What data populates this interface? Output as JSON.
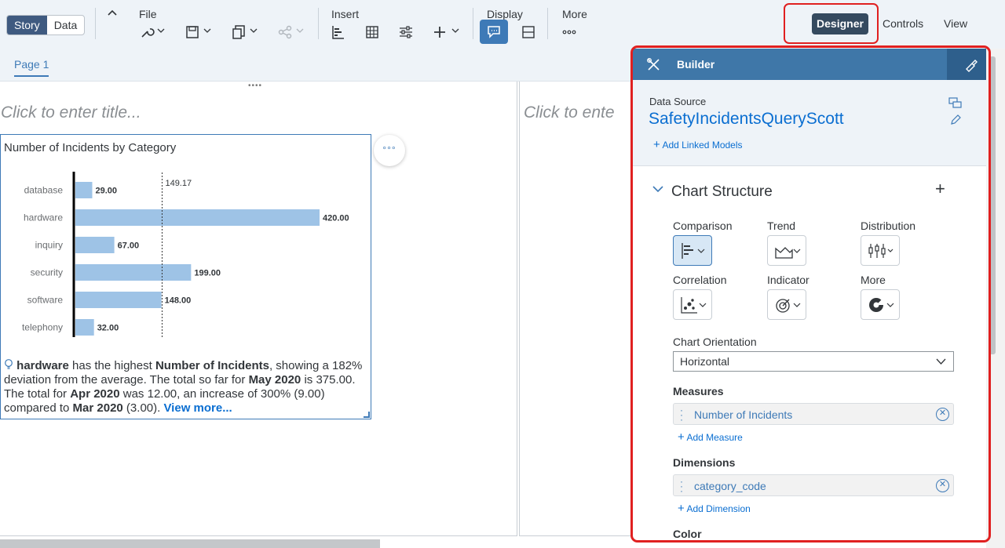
{
  "toolbar": {
    "modes": [
      "Story",
      "Data"
    ],
    "groups": {
      "file": "File",
      "insert": "Insert",
      "display": "Display",
      "more": "More"
    },
    "designer": "Designer",
    "controls": "Controls",
    "view": "View",
    "icons": [
      "collapse-icon",
      "wrench-icon",
      "save-icon",
      "copy-icon",
      "share-icon",
      "bar-chart-icon",
      "table-icon",
      "filter-settings-icon",
      "add-icon",
      "comment-icon",
      "section-icon",
      "more-dots-icon"
    ]
  },
  "pages": {
    "tab1": "Page 1"
  },
  "canvas": {
    "title_placeholder": "Click to enter title...",
    "title_placeholder_partial": "Click to ente"
  },
  "chart": {
    "chart_data": {
      "type": "bar",
      "title": "Number of Incidents by Category",
      "categories": [
        "database",
        "hardware",
        "inquiry",
        "security",
        "software",
        "telephony"
      ],
      "values": [
        29,
        420,
        67,
        199,
        148,
        32
      ],
      "value_labels": [
        "29.00",
        "420.00",
        "67.00",
        "199.00",
        "148.00",
        "32.00"
      ],
      "reference_line": 149.17,
      "reference_label": "149.17",
      "orientation": "horizontal",
      "xlim": [
        0,
        430
      ],
      "colors": {
        "bar": "#9ec3e6",
        "axis": "#000000",
        "reference": "#333333"
      }
    },
    "insight": {
      "p1": "hardware",
      "p2": " has the highest ",
      "p3": "Number of Incidents",
      "p4": ", showing a 182% deviation from the average. The total so far for ",
      "p5": "May 2020",
      "p6": " is 375.00. The total for ",
      "p7": "Apr 2020",
      "p8": " was 12.00, an increase of 300% (9.00) compared to ",
      "p9": "Mar 2020",
      "p10": " (3.00). ",
      "view_more": "View more..."
    },
    "more_menu": "°°°"
  },
  "builder": {
    "title": "Builder",
    "data_source_label": "Data Source",
    "data_source_name": "SafetyIncidentsQueryScott",
    "add_linked_models": "Add Linked Models",
    "chart_structure": "Chart Structure",
    "types": {
      "comparison": "Comparison",
      "trend": "Trend",
      "distribution": "Distribution",
      "correlation": "Correlation",
      "indicator": "Indicator",
      "more": "More"
    },
    "orientation_label": "Chart Orientation",
    "orientation_value": "Horizontal",
    "measures_label": "Measures",
    "measure_1": "Number of Incidents",
    "add_measure": "Add Measure",
    "dimensions_label": "Dimensions",
    "dimension_1": "category_code",
    "add_dimension": "Add Dimension",
    "color_label": "Color"
  },
  "colors": {
    "accent": "#0a6ed1",
    "header": "#3f77a8",
    "highlight": "#e02020",
    "designer_btn": "#354a5f"
  }
}
